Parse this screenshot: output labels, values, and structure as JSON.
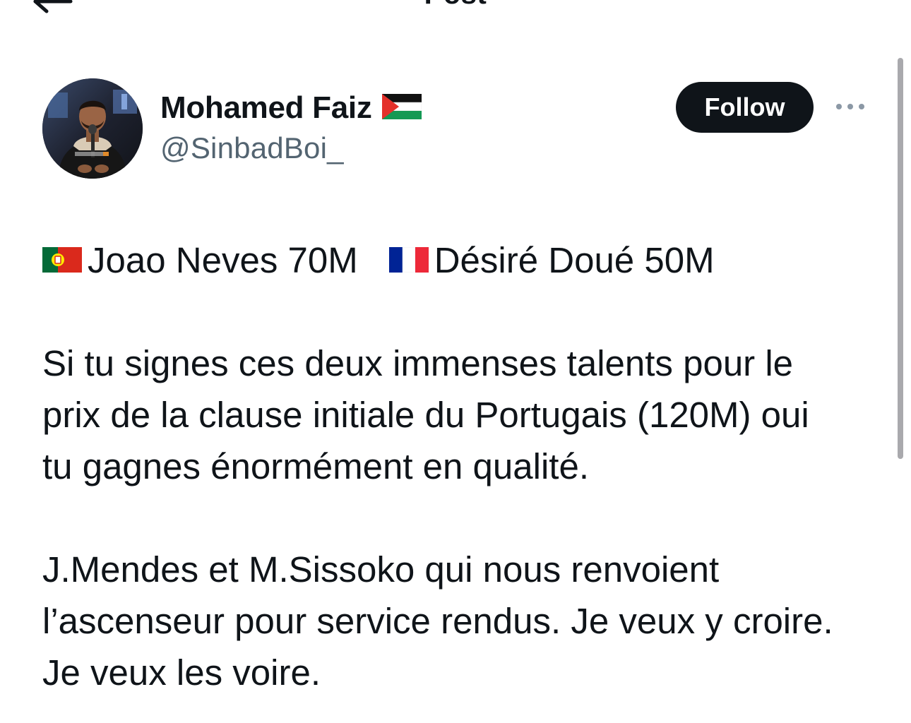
{
  "header": {
    "title": "Post",
    "back_icon": "arrow-left-icon"
  },
  "author": {
    "name": "Mohamed Faiz",
    "name_flag": "palestine-flag-icon",
    "handle": "@SinbadBoi_",
    "avatar": "avatar-photo"
  },
  "actions": {
    "follow_label": "Follow",
    "more_icon": "more-dots-icon"
  },
  "tweet": {
    "line1_player1": "Joao Neves 70M",
    "line1_player1_flag": "portugal-flag-icon",
    "line1_player2": "Désiré Doué 50M",
    "line1_player2_flag": "france-flag-icon",
    "paragraph2": [
      "Si tu signes ces deux immenses talents pour le",
      "prix de la clause initiale du Portugais (120M) oui",
      "tu gagnes énormément en qualité."
    ],
    "paragraph3": [
      "J.Mendes et M.Sissoko qui nous renvoient",
      "l’ascenseur pour service rendus. Je veux y croire.",
      "Je veux les voire."
    ]
  },
  "colors": {
    "text": "#0f1419",
    "secondary_text": "#536471",
    "follow_bg": "#0f1419",
    "follow_text": "#ffffff",
    "background": "#ffffff"
  }
}
